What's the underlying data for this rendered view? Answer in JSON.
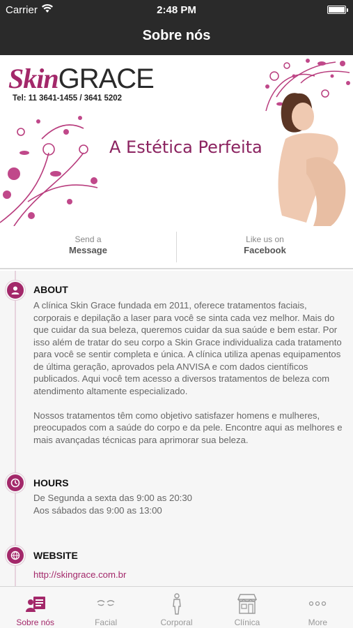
{
  "status": {
    "carrier": "Carrier",
    "time": "2:48 PM"
  },
  "nav": {
    "title": "Sobre nós"
  },
  "banner": {
    "logo_skin": "Skin",
    "logo_grace": "GRACE",
    "tel": "Tel: 11 3641-1455 / 3641 5202",
    "tagline": "A Estética Perfeita"
  },
  "actions": [
    {
      "small": "Send a",
      "big": "Message"
    },
    {
      "small": "Like us on",
      "big": "Facebook"
    }
  ],
  "about": {
    "title": "ABOUT",
    "p1": "A clínica Skin Grace fundada em 2011, oferece tratamentos faciais, corporais e depilação a laser para você se sinta cada vez melhor. Mais do que cuidar da sua beleza, queremos cuidar da sua saúde e bem estar. Por isso além de tratar do seu corpo a Skin Grace individualiza cada tratamento para você se sentir completa e única. A clínica utiliza apenas equipamentos de última geração, aprovados pela ANVISA e com dados científicos publicados. Aqui você tem acesso a diversos tratamentos de beleza com atendimento altamente especializado.",
    "p2": "Nossos tratamentos têm como objetivo satisfazer homens e mulheres, preocupados com a saúde do corpo e da pele. Encontre aqui as melhores e mais avançadas técnicas para aprimorar sua beleza."
  },
  "hours": {
    "title": "HOURS",
    "line1": "De Segunda a sexta das 9:00 as 20:30",
    "line2": "Aos sábados das 9:00 as 13:00"
  },
  "website": {
    "title": "WEBSITE",
    "url": "http://skingrace.com.br"
  },
  "tabs": [
    {
      "label": "Sobre nós",
      "icon": "about-icon",
      "active": true
    },
    {
      "label": "Facial",
      "icon": "face-icon",
      "active": false
    },
    {
      "label": "Corporal",
      "icon": "body-icon",
      "active": false
    },
    {
      "label": "Clínica",
      "icon": "store-icon",
      "active": false
    },
    {
      "label": "More",
      "icon": "more-icon",
      "active": false
    }
  ],
  "colors": {
    "accent": "#a3286a",
    "navbar": "#2a2a2a",
    "content_bg": "#f6f6f6"
  }
}
